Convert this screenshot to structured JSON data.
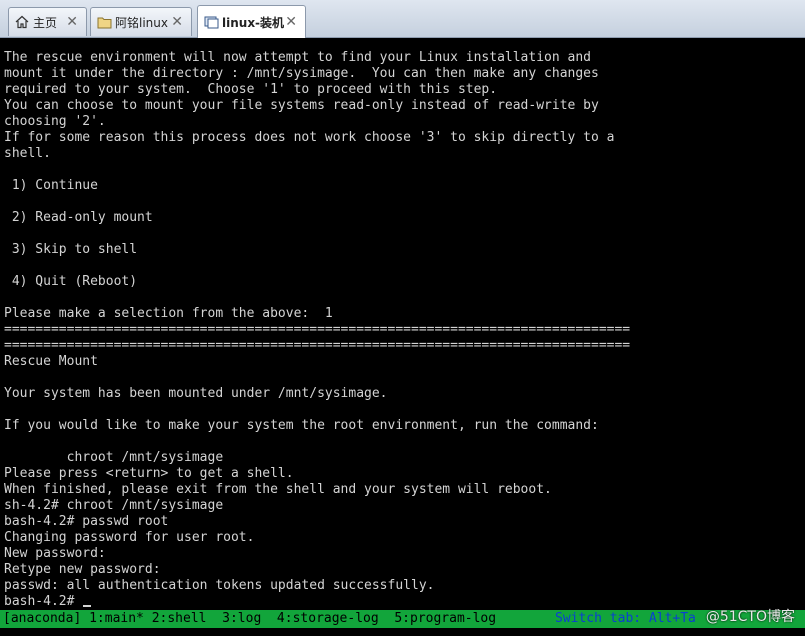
{
  "tabs": [
    {
      "label": "主页",
      "icon": "home-icon",
      "close": "✕",
      "active": false
    },
    {
      "label": "阿铭linux",
      "icon": "folder-icon",
      "close": "✕",
      "active": false
    },
    {
      "label": "linux-装机",
      "icon": "vm-icon",
      "close": "✕",
      "active": true
    }
  ],
  "terminal": {
    "lines": [
      "The rescue environment will now attempt to find your Linux installation and",
      "mount it under the directory : /mnt/sysimage.  You can then make any changes",
      "required to your system.  Choose '1' to proceed with this step.",
      "You can choose to mount your file systems read-only instead of read-write by",
      "choosing '2'.",
      "If for some reason this process does not work choose '3' to skip directly to a",
      "shell.",
      "",
      " 1) Continue",
      "",
      " 2) Read-only mount",
      "",
      " 3) Skip to shell",
      "",
      " 4) Quit (Reboot)",
      "",
      "Please make a selection from the above:  1",
      "================================================================================",
      "================================================================================",
      "Rescue Mount",
      "",
      "Your system has been mounted under /mnt/sysimage.",
      "",
      "If you would like to make your system the root environment, run the command:",
      "",
      "        chroot /mnt/sysimage",
      "Please press <return> to get a shell.",
      "When finished, please exit from the shell and your system will reboot.",
      "sh-4.2# chroot /mnt/sysimage",
      "bash-4.2# passwd root",
      "Changing password for user root.",
      "New password:",
      "Retype new password:",
      "passwd: all authentication tokens updated successfully.",
      "bash-4.2# "
    ]
  },
  "statusbar": {
    "left": "[anaconda] 1:main* 2:shell  3:log  4:storage-log  5:program-log",
    "right": "Switch tab: Alt+Ta"
  },
  "watermark": "@51CTO博客",
  "colors": {
    "terminal_bg": "#000000",
    "terminal_fg": "#d4d4d4",
    "status_bg": "#12a53b",
    "status_right_fg": "#0b3fd1"
  }
}
